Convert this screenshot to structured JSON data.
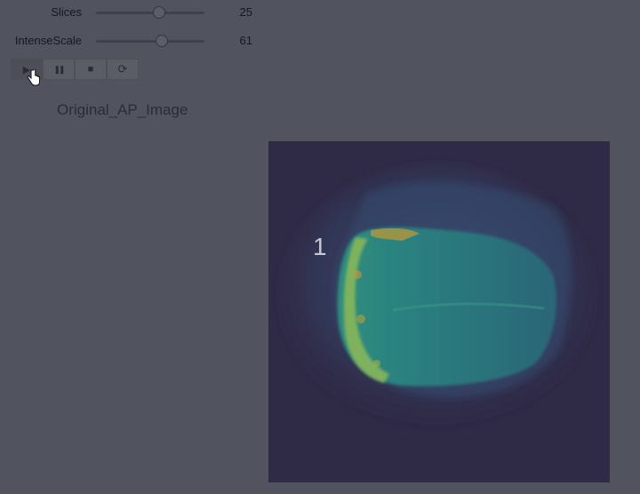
{
  "controls": {
    "sliders": [
      {
        "label": "Slices",
        "value": "25",
        "fraction": 0.58
      },
      {
        "label": "IntenseScale",
        "value": "61",
        "fraction": 0.61
      }
    ],
    "playback": {
      "buttons": [
        {
          "name": "play",
          "glyph": "▶"
        },
        {
          "name": "pause",
          "glyph": "❚❚"
        },
        {
          "name": "stop",
          "glyph": "■"
        },
        {
          "name": "loop",
          "glyph": "⟳"
        }
      ]
    }
  },
  "figure": {
    "caption": "Original_AP_Image",
    "marker_label": "1",
    "colormap": [
      "#2f2a46",
      "#36456a",
      "#2a6f7a",
      "#2f8e7e",
      "#7fb95a",
      "#c89a35"
    ]
  }
}
